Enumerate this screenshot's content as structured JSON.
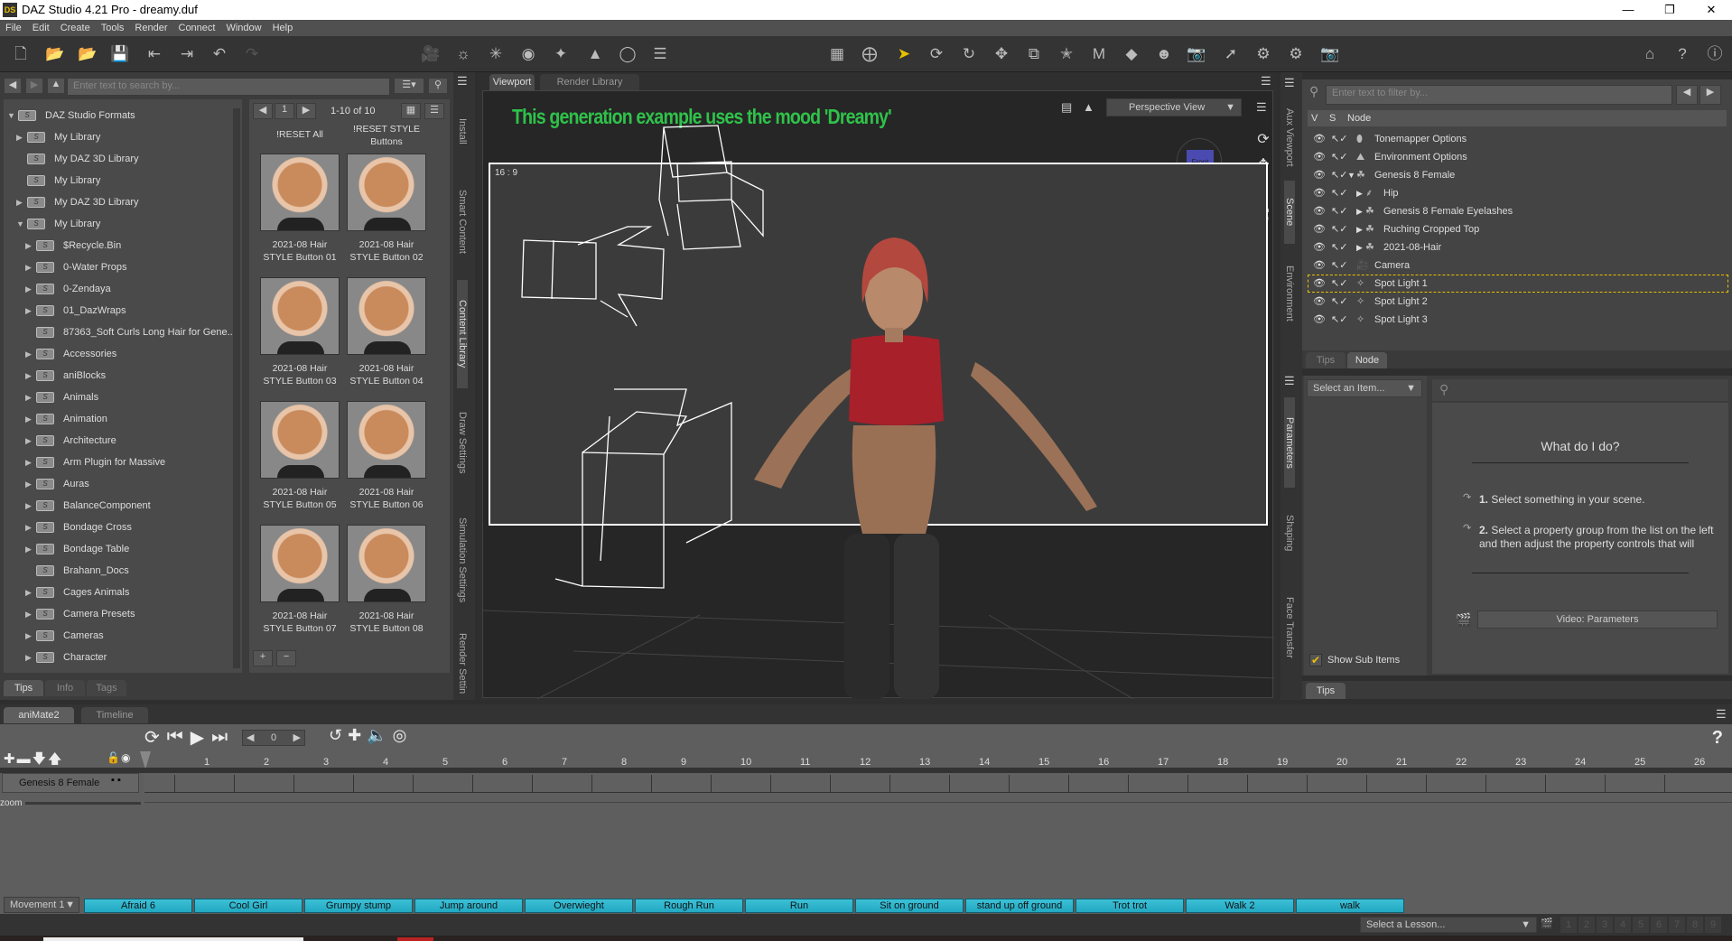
{
  "window": {
    "title": "DAZ Studio 4.21 Pro - dreamy.duf",
    "logo": "DS"
  },
  "menu": [
    "File",
    "Edit",
    "Create",
    "Tools",
    "Render",
    "Connect",
    "Window",
    "Help"
  ],
  "content_library": {
    "search_placeholder": "Enter text to search by...",
    "tree": [
      {
        "label": "DAZ Studio Formats",
        "level": 0,
        "arrow": "expanded"
      },
      {
        "label": "My Library",
        "level": 1,
        "arrow": "collapsed"
      },
      {
        "label": "My DAZ 3D Library",
        "level": 1,
        "arrow": "none"
      },
      {
        "label": "My Library",
        "level": 1,
        "arrow": "none"
      },
      {
        "label": "My DAZ 3D Library",
        "level": 1,
        "arrow": "collapsed"
      },
      {
        "label": "My Library",
        "level": 1,
        "arrow": "expanded"
      },
      {
        "label": "$Recycle.Bin",
        "level": 2,
        "arrow": "collapsed"
      },
      {
        "label": "0-Water Props",
        "level": 2,
        "arrow": "collapsed"
      },
      {
        "label": "0-Zendaya",
        "level": 2,
        "arrow": "collapsed"
      },
      {
        "label": "01_DazWraps",
        "level": 2,
        "arrow": "collapsed"
      },
      {
        "label": "87363_Soft Curls Long Hair for Gene...",
        "level": 2,
        "arrow": "none"
      },
      {
        "label": "Accessories",
        "level": 2,
        "arrow": "collapsed"
      },
      {
        "label": "aniBlocks",
        "level": 2,
        "arrow": "collapsed"
      },
      {
        "label": "Animals",
        "level": 2,
        "arrow": "collapsed"
      },
      {
        "label": "Animation",
        "level": 2,
        "arrow": "collapsed"
      },
      {
        "label": "Architecture",
        "level": 2,
        "arrow": "collapsed"
      },
      {
        "label": "Arm Plugin for Massive",
        "level": 2,
        "arrow": "collapsed"
      },
      {
        "label": "Auras",
        "level": 2,
        "arrow": "collapsed"
      },
      {
        "label": "BalanceComponent",
        "level": 2,
        "arrow": "collapsed"
      },
      {
        "label": "Bondage Cross",
        "level": 2,
        "arrow": "collapsed"
      },
      {
        "label": "Bondage Table",
        "level": 2,
        "arrow": "collapsed"
      },
      {
        "label": "Brahann_Docs",
        "level": 2,
        "arrow": "none"
      },
      {
        "label": "Cages Animals",
        "level": 2,
        "arrow": "collapsed"
      },
      {
        "label": "Camera Presets",
        "level": 2,
        "arrow": "collapsed"
      },
      {
        "label": "Cameras",
        "level": 2,
        "arrow": "collapsed"
      },
      {
        "label": "Character",
        "level": 2,
        "arrow": "collapsed"
      }
    ],
    "page": "1",
    "range": "1-10 of 10",
    "header_items": [
      "!RESET All",
      "!RESET STYLE Buttons"
    ],
    "items": [
      "2021-08 Hair STYLE Button 01",
      "2021-08 Hair STYLE Button 02",
      "2021-08 Hair STYLE Button 03",
      "2021-08 Hair STYLE Button 04",
      "2021-08 Hair STYLE Button 05",
      "2021-08 Hair STYLE Button 06",
      "2021-08 Hair STYLE Button 07",
      "2021-08 Hair STYLE Button 08"
    ],
    "bottom_tabs": [
      "Tips",
      "Info",
      "Tags"
    ],
    "side_tabs": [
      "Install",
      "Smart Content",
      "Content Library",
      "Draw Settings",
      "Simulation Settings",
      "Render Settin"
    ]
  },
  "viewport": {
    "tabs": [
      "Viewport",
      "Render Library"
    ],
    "view_select": "Perspective View",
    "overlay_text": "This generation example uses the mood 'Dreamy'",
    "aspect": "16 : 9",
    "cube_face": "Front",
    "overlay_color": "#2fc24a"
  },
  "scene": {
    "filter_placeholder": "Enter text to filter by...",
    "columns": [
      "V",
      "S",
      "Node"
    ],
    "nodes": [
      {
        "label": "Tonemapper Options",
        "indent": 0,
        "arrow": "none",
        "icon": "tonemapper-icon"
      },
      {
        "label": "Environment Options",
        "indent": 0,
        "arrow": "none",
        "icon": "environment-icon"
      },
      {
        "label": "Genesis 8 Female",
        "indent": 0,
        "arrow": "expanded",
        "icon": "figure-icon"
      },
      {
        "label": "Hip",
        "indent": 1,
        "arrow": "collapsed",
        "icon": "bone-icon"
      },
      {
        "label": "Genesis 8 Female Eyelashes",
        "indent": 1,
        "arrow": "collapsed",
        "icon": "figure-icon"
      },
      {
        "label": "Ruching Cropped Top",
        "indent": 1,
        "arrow": "collapsed",
        "icon": "figure-icon"
      },
      {
        "label": "2021-08-Hair",
        "indent": 1,
        "arrow": "collapsed",
        "icon": "figure-icon"
      },
      {
        "label": "Camera",
        "indent": 0,
        "arrow": "none",
        "icon": "camera-icon"
      },
      {
        "label": "Spot Light 1",
        "indent": 0,
        "arrow": "none",
        "icon": "spotlight-icon",
        "selected": true
      },
      {
        "label": "Spot Light 2",
        "indent": 0,
        "arrow": "none",
        "icon": "spotlight-icon"
      },
      {
        "label": "Spot Light 3",
        "indent": 0,
        "arrow": "none",
        "icon": "spotlight-icon"
      }
    ],
    "side_tabs": [
      "Aux Viewport",
      "Scene",
      "Environment"
    ],
    "tabs": [
      "Tips",
      "Node"
    ]
  },
  "parameters": {
    "select_item": "Select an Item...",
    "heading": "What do I do?",
    "step1_num": "1.",
    "step1": "Select something in your scene.",
    "step2_num": "2.",
    "step2": "Select a property group from the list on the left and then adjust the property controls that will",
    "video_button": "Video: Parameters",
    "show_sub_items": "Show Sub Items",
    "show_sub_items_checked": true,
    "side_tabs": [
      "Parameters",
      "Shaping",
      "Face Transfer"
    ],
    "bottom_tab": "Tips"
  },
  "animate": {
    "tabs": [
      "aniMate2",
      "Timeline"
    ],
    "frame": "0",
    "ticks": [
      "1",
      "2",
      "3",
      "4",
      "5",
      "6",
      "7",
      "8",
      "9",
      "10",
      "11",
      "12",
      "13",
      "14",
      "15",
      "16",
      "17",
      "18",
      "19",
      "20",
      "21",
      "22",
      "23",
      "24",
      "25",
      "26"
    ],
    "track": "Genesis 8 Female",
    "zoom_label": "zoom",
    "help": "?",
    "group_select": "Movement 1",
    "blocks": [
      "Afraid 6",
      "Cool Girl",
      "Grumpy stump",
      "Jump around",
      "Overwieght",
      "Rough Run",
      "Run",
      "Sit on ground",
      "stand up off ground",
      "Trot trot",
      "Walk 2",
      "walk"
    ],
    "block_color": "#22a9c2"
  },
  "status": {
    "lesson_select": "Select a Lesson...",
    "lesson_pages": [
      "1",
      "2",
      "3",
      "4",
      "5",
      "6",
      "7",
      "8",
      "9"
    ]
  }
}
